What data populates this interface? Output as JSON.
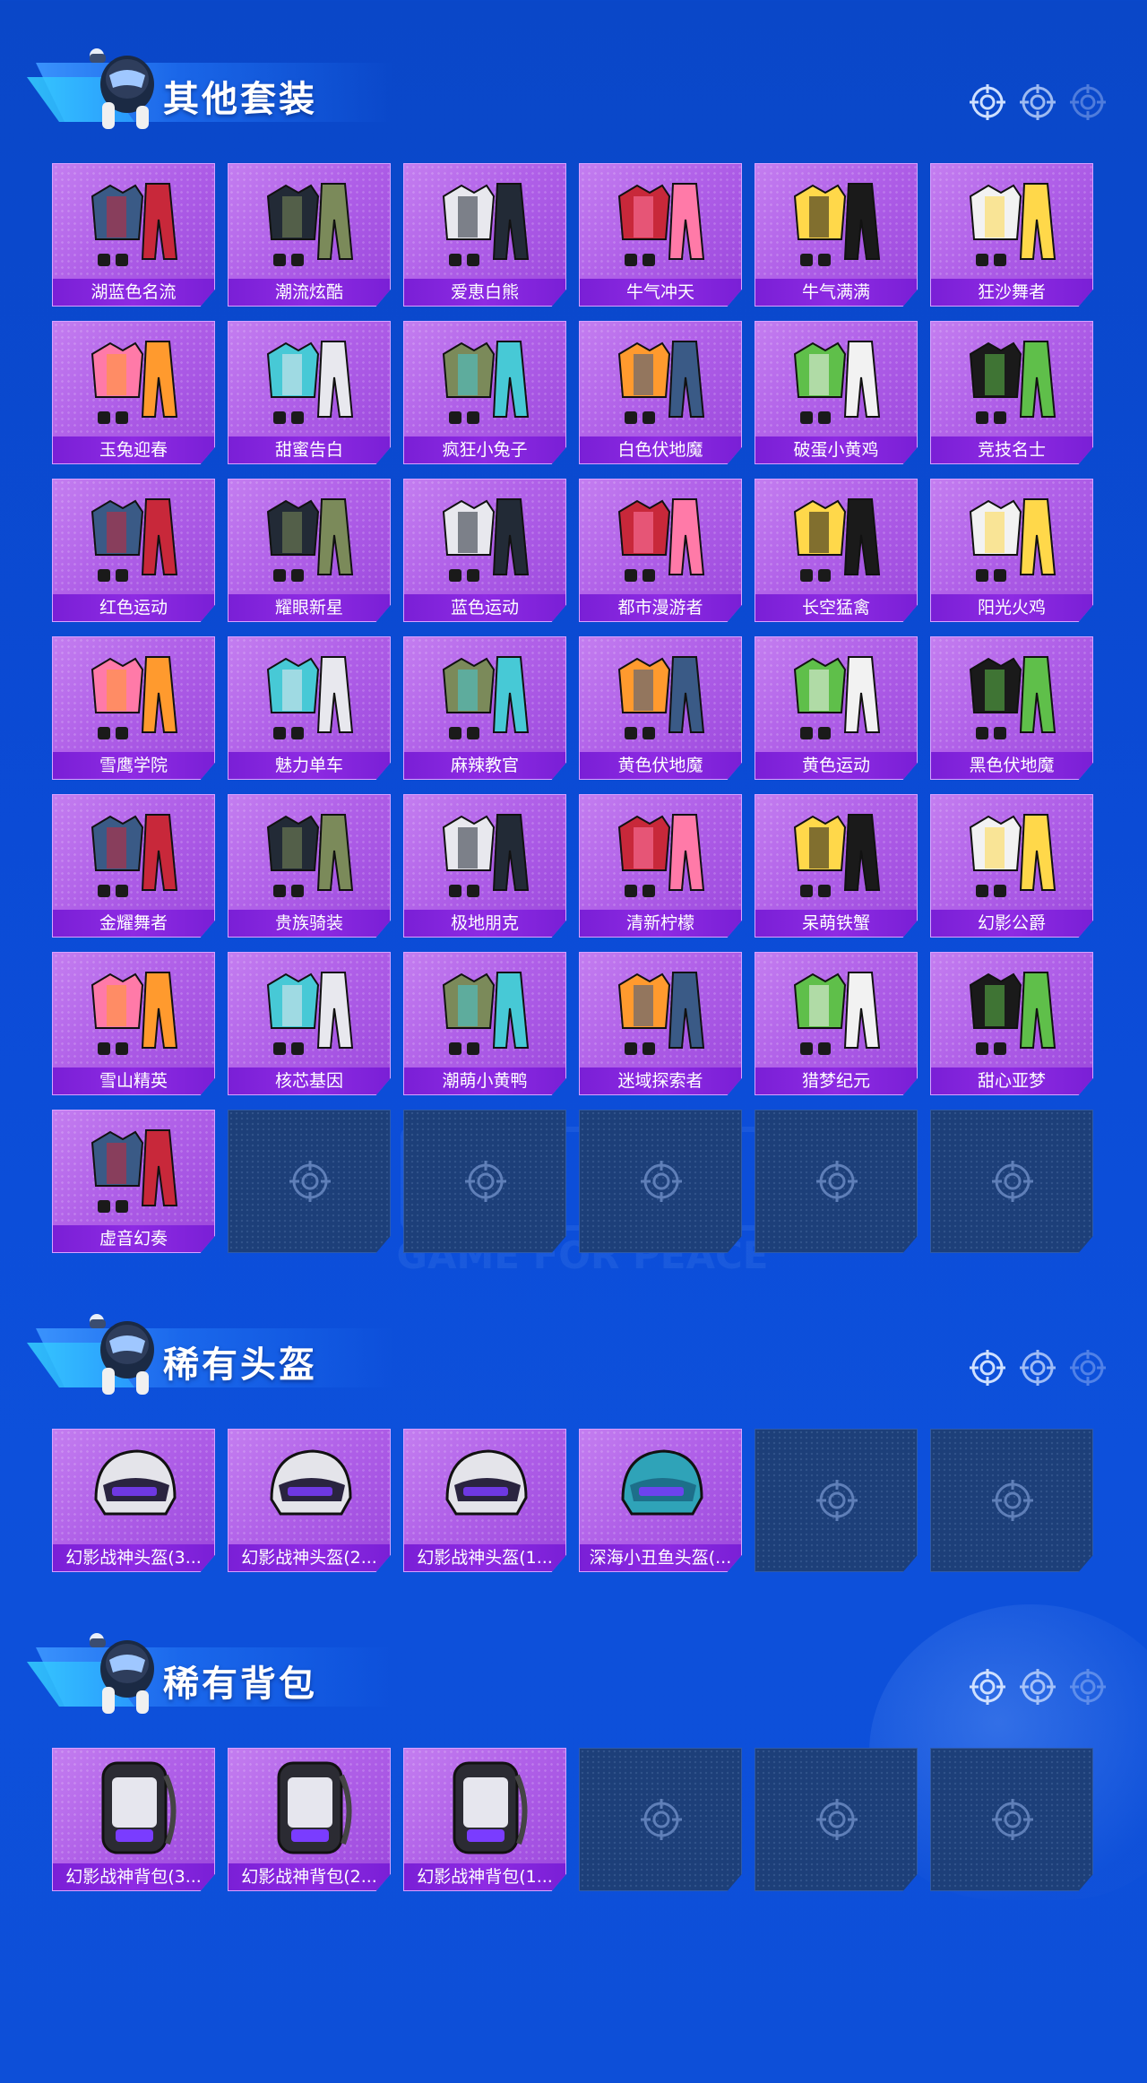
{
  "colors": {
    "background": "#0b4bd6",
    "card_purple": "#b060e8",
    "label_bar": "#7a1fd6",
    "empty_slot": "#1d3f79"
  },
  "background_watermark": "GAME FOR PEACE",
  "sections": [
    {
      "title": "其他套装",
      "icon": "skydiver-mascot-icon",
      "items": [
        "湖蓝色名流",
        "潮流炫酷",
        "爱恵白熊",
        "牛气冲天",
        "牛气满满",
        "狂沙舞者",
        "玉兔迎春",
        "甜蜜告白",
        "疯狂小兔子",
        "白色伏地魔",
        "破蛋小黄鸡",
        "竞技名士",
        "红色运动",
        "耀眼新星",
        "蓝色运动",
        "都市漫游者",
        "长空猛禽",
        "阳光火鸡",
        "雪鹰学院",
        "魅力单车",
        "麻辣教官",
        "黄色伏地魔",
        "黄色运动",
        "黑色伏地魔",
        "金耀舞者",
        "贵族骑装",
        "极地朋克",
        "清新柠檬",
        "呆萌铁蟹",
        "幻影公爵",
        "雪山精英",
        "核芯基因",
        "潮萌小黄鸭",
        "迷域探索者",
        "猎梦纪元",
        "甜心亚梦",
        "虚音幻奏"
      ],
      "empty_slots": 5
    },
    {
      "title": "稀有头盔",
      "icon": "skydiver-mascot-icon",
      "items": [
        "幻影战神头盔(3...",
        "幻影战神头盔(2...",
        "幻影战神头盔(1...",
        "深海小丑鱼头盔(..."
      ],
      "empty_slots": 2
    },
    {
      "title": "稀有背包",
      "icon": "skydiver-mascot-icon",
      "items": [
        "幻影战神背包(3...",
        "幻影战神背包(2...",
        "幻影战神背包(1..."
      ],
      "empty_slots": 3
    }
  ]
}
